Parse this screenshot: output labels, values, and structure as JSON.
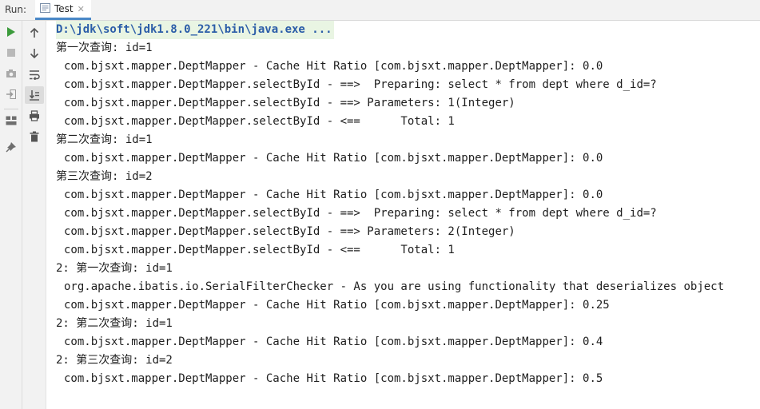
{
  "run_panel": {
    "label": "Run:",
    "tab_label": "Test",
    "tab_close": "✕",
    "tab_icon": "run-config-icon"
  },
  "toolbar": {
    "buttons": [
      {
        "name": "rerun",
        "icon": "play-icon",
        "color": "#3c9b3c"
      },
      {
        "name": "stop",
        "icon": "stop-icon",
        "color": "#b9b9b9"
      },
      {
        "name": "screenshot",
        "icon": "camera-icon",
        "color": "#9a9a9a"
      },
      {
        "name": "restore-layout",
        "icon": "login-icon",
        "color": "#9a9a9a"
      },
      {
        "name": "layout",
        "icon": "grid-layout-icon",
        "color": "#6e6e6e"
      },
      {
        "name": "pin",
        "icon": "pin-icon",
        "color": "#6e6e6e"
      },
      {
        "name": "scroll-up",
        "icon": "arrow-up-icon",
        "color": "#555555"
      },
      {
        "name": "scroll-down",
        "icon": "arrow-down-icon",
        "color": "#555555"
      },
      {
        "name": "soft-wrap",
        "icon": "soft-wrap-icon",
        "color": "#555555"
      },
      {
        "name": "scroll-to-end",
        "icon": "scroll-to-end-icon",
        "color": "#555555"
      },
      {
        "name": "print",
        "icon": "print-icon",
        "color": "#555555"
      },
      {
        "name": "clear",
        "icon": "trash-icon",
        "color": "#555555"
      }
    ]
  },
  "console": {
    "command": "D:\\jdk\\soft\\jdk1.8.0_221\\bin\\java.exe ...",
    "lines": [
      "第一次查询: id=1",
      "com.bjsxt.mapper.DeptMapper - Cache Hit Ratio [com.bjsxt.mapper.DeptMapper]: 0.0",
      "com.bjsxt.mapper.DeptMapper.selectById - ==>  Preparing: select * from dept where d_id=?",
      "com.bjsxt.mapper.DeptMapper.selectById - ==> Parameters: 1(Integer)",
      "com.bjsxt.mapper.DeptMapper.selectById - <==      Total: 1",
      "第二次查询: id=1",
      "com.bjsxt.mapper.DeptMapper - Cache Hit Ratio [com.bjsxt.mapper.DeptMapper]: 0.0",
      "第三次查询: id=2",
      "com.bjsxt.mapper.DeptMapper - Cache Hit Ratio [com.bjsxt.mapper.DeptMapper]: 0.0",
      "com.bjsxt.mapper.DeptMapper.selectById - ==>  Preparing: select * from dept where d_id=?",
      "com.bjsxt.mapper.DeptMapper.selectById - ==> Parameters: 2(Integer)",
      "com.bjsxt.mapper.DeptMapper.selectById - <==      Total: 1",
      "2: 第一次查询: id=1",
      "org.apache.ibatis.io.SerialFilterChecker - As you are using functionality that deserializes object",
      "com.bjsxt.mapper.DeptMapper - Cache Hit Ratio [com.bjsxt.mapper.DeptMapper]: 0.25",
      "2: 第二次查询: id=1",
      "com.bjsxt.mapper.DeptMapper - Cache Hit Ratio [com.bjsxt.mapper.DeptMapper]: 0.4",
      "2: 第三次查询: id=2",
      "com.bjsxt.mapper.DeptMapper - Cache Hit Ratio [com.bjsxt.mapper.DeptMapper]: 0.5"
    ]
  }
}
